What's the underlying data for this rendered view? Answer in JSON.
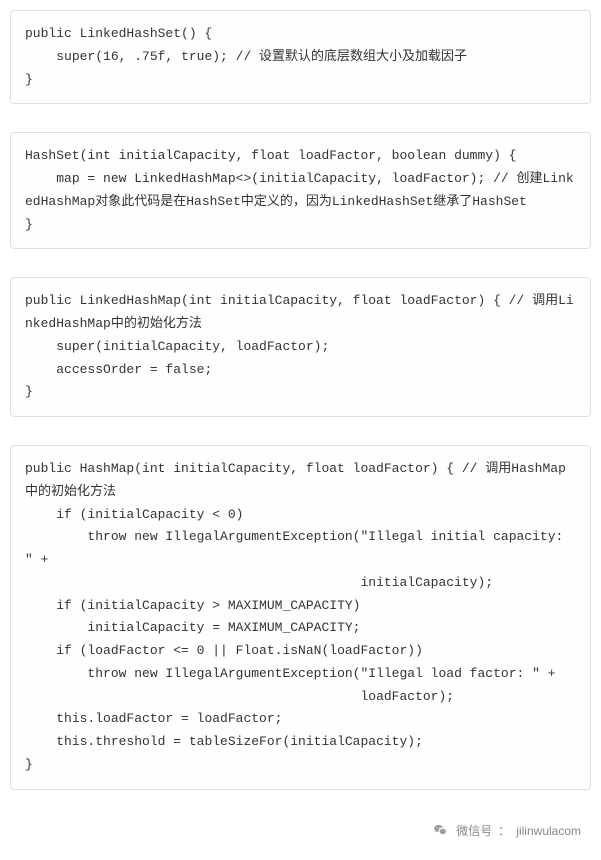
{
  "code_blocks": [
    "public LinkedHashSet() {\n    super(16, .75f, true); // 设置默认的底层数组大小及加载因子\n}",
    "HashSet(int initialCapacity, float loadFactor, boolean dummy) {\n    map = new LinkedHashMap<>(initialCapacity, loadFactor); // 创建LinkedHashMap对象此代码是在HashSet中定义的，因为LinkedHashSet继承了HashSet\n}",
    "public LinkedHashMap(int initialCapacity, float loadFactor) { // 调用LinkedHashMap中的初始化方法\n    super(initialCapacity, loadFactor);\n    accessOrder = false;\n}",
    "public HashMap(int initialCapacity, float loadFactor) { // 调用HashMap中的初始化方法\n    if (initialCapacity < 0)\n        throw new IllegalArgumentException(\"Illegal initial capacity: \" +\n                                           initialCapacity);\n    if (initialCapacity > MAXIMUM_CAPACITY)\n        initialCapacity = MAXIMUM_CAPACITY;\n    if (loadFactor <= 0 || Float.isNaN(loadFactor))\n        throw new IllegalArgumentException(\"Illegal load factor: \" +\n                                           loadFactor);\n    this.loadFactor = loadFactor;\n    this.threshold = tableSizeFor(initialCapacity);\n}"
  ],
  "footer": {
    "label": "微信号",
    "separator": "：",
    "value": "jilinwulacom"
  }
}
